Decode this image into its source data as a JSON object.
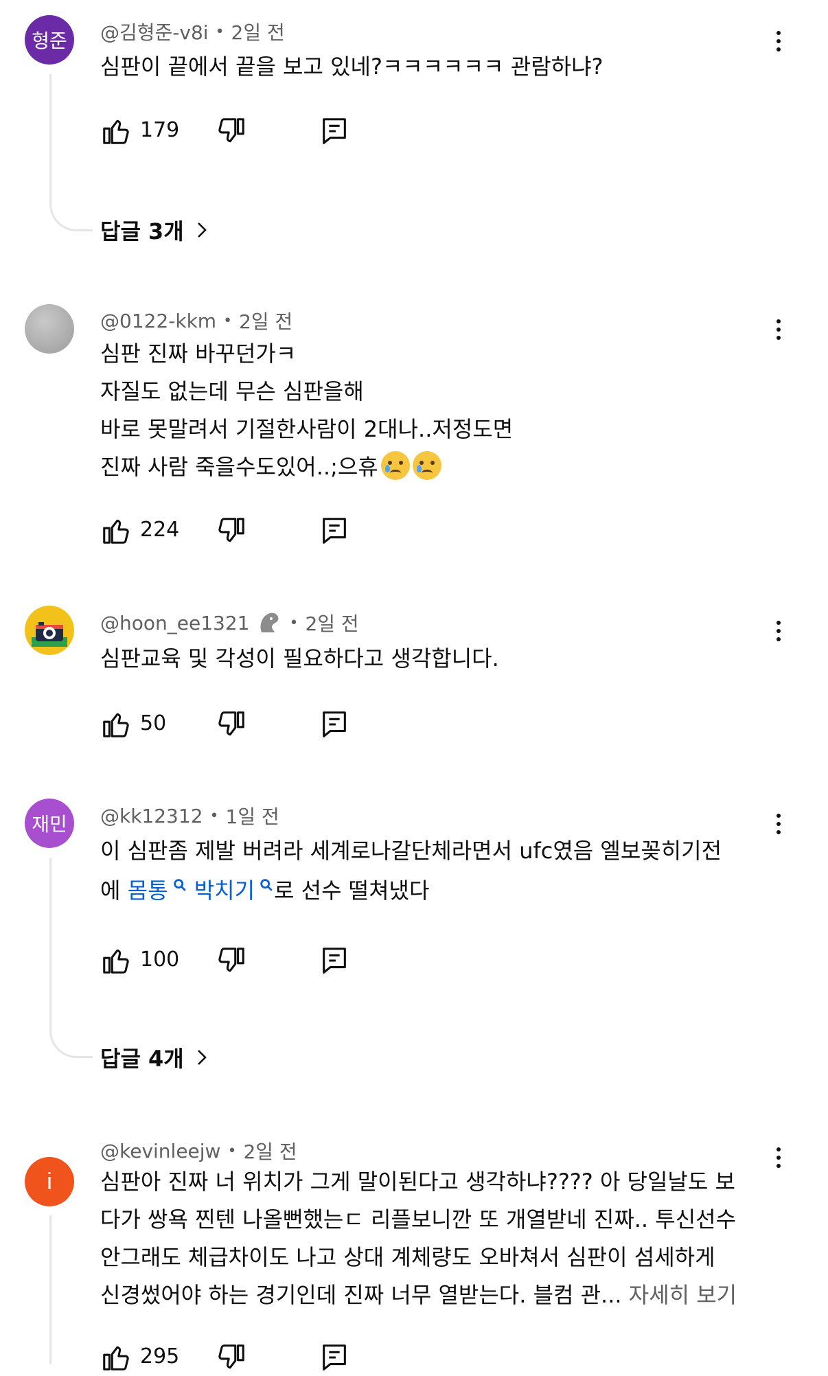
{
  "colors": {
    "link": "#065fd4",
    "secondary": "#606060",
    "avatar_purple": "#6b2aa6",
    "avatar_violet": "#a84fd0",
    "avatar_orange": "#f0531c",
    "avatar_gray": "#9b9b9b"
  },
  "comments": [
    {
      "avatar_text": "형준",
      "author": "@김형준-v8i",
      "time": "2일 전",
      "lines": [
        "심판이 끝에서 끝을 보고 있네?ㅋㅋㅋㅋㅋㅋ 관람하냐?"
      ],
      "likes": "179",
      "replies": "답글 3개"
    },
    {
      "avatar_text": "",
      "author": "@0122-kkm",
      "time": "2일 전",
      "lines": [
        "심판 진짜 바꾸던가ㅋ",
        "자질도 없는데 무슨 심판을해",
        "바로 못말려서 기절한사람이 2대나..저정도면",
        "진짜 사람 죽을수도있어..;으휴"
      ],
      "likes": "224"
    },
    {
      "avatar_text": "",
      "author": "@hoon_ee1321",
      "time": "2일 전",
      "lines": [
        "심판교육 및 각성이 필요하다고 생각합니다."
      ],
      "likes": "50"
    },
    {
      "avatar_text": "재민",
      "author": "@kk12312",
      "time": "1일 전",
      "line1": "이 심판좀 제발 버려라 세계로나갈단체라면서 ufc였음 엘보꽂히기전",
      "line2_pre": "에 ",
      "link1": "몸통",
      "link2": "박치기",
      "line2_post": "로 선수 떨쳐냈다",
      "likes": "100",
      "replies": "답글 4개"
    },
    {
      "avatar_text": "i",
      "author": "@kevinleejw",
      "time": "2일 전",
      "lines": [
        "심판아 진짜 너 위치가 그게 말이된다고 생각하냐???? 아 당일날도 보",
        "다가 쌍욕 찐텐 나올뻔했는ㄷ 리플보니깐 또 개열받네 진짜.. 투신선수",
        "안그래도 체급차이도 나고 상대 계체량도 오바쳐서 심판이 섬세하게"
      ],
      "last_line": "신경썼어야 하는 경기인데 진짜 너무 열받는다. 블컴 관...",
      "read_more": "자세히 보기",
      "likes": "295"
    }
  ]
}
